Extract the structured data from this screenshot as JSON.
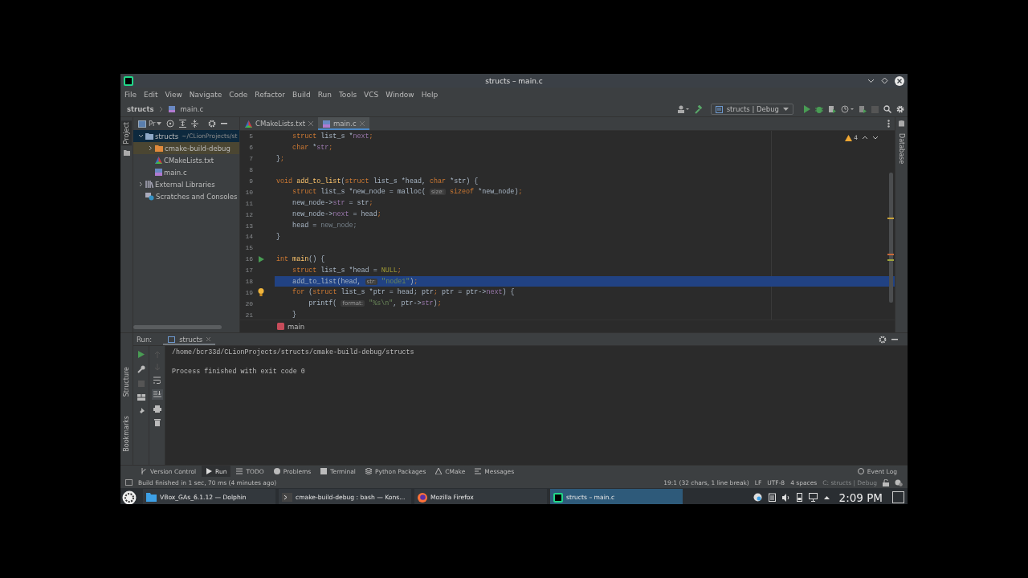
{
  "window": {
    "title": "structs – main.c"
  },
  "menu": [
    "File",
    "Edit",
    "View",
    "Navigate",
    "Code",
    "Refactor",
    "Build",
    "Run",
    "Tools",
    "VCS",
    "Window",
    "Help"
  ],
  "breadcrumb": [
    "structs",
    "main.c"
  ],
  "run_config": "structs | Debug",
  "left_strip": [
    "Project"
  ],
  "right_strip": [
    "Database"
  ],
  "project": {
    "title": "Pr",
    "tree": [
      {
        "label": "structs",
        "path": "~/CLionProjects/st",
        "kind": "project",
        "expanded": true,
        "selected": true,
        "children": [
          {
            "label": "cmake-build-debug",
            "kind": "excluded_folder",
            "expanded": false,
            "selected": false
          },
          {
            "label": "CMakeLists.txt",
            "kind": "cmake",
            "selected": false
          },
          {
            "label": "main.c",
            "kind": "c_file",
            "selected": false
          }
        ]
      },
      {
        "label": "External Libraries",
        "kind": "libraries",
        "expanded": false,
        "selected": false
      },
      {
        "label": "Scratches and Consoles",
        "kind": "scratches",
        "selected": false
      }
    ]
  },
  "editor_tabs": [
    {
      "label": "CMakeLists.txt",
      "kind": "cmake",
      "selected": false
    },
    {
      "label": "main.c",
      "kind": "c_file",
      "selected": true
    }
  ],
  "warnings": "4",
  "lines": [
    {
      "n": "5",
      "selected": false,
      "tokens": [
        {
          "kind": "kw",
          "text": "    struct"
        },
        {
          "kind": "plain",
          "text": " list_s *"
        },
        {
          "kind": "field",
          "text": "next"
        },
        {
          "kind": "kw",
          "text": ";"
        }
      ]
    },
    {
      "n": "6",
      "selected": false,
      "tokens": [
        {
          "kind": "kw",
          "text": "    char"
        },
        {
          "kind": "plain",
          "text": " *"
        },
        {
          "kind": "field",
          "text": "str"
        },
        {
          "kind": "kw",
          "text": ";"
        }
      ]
    },
    {
      "n": "7",
      "selected": false,
      "tokens": [
        {
          "kind": "plain",
          "text": "}"
        },
        {
          "kind": "kw",
          "text": ";"
        }
      ]
    },
    {
      "n": "8",
      "selected": false,
      "kind": "blank"
    },
    {
      "n": "9",
      "selected": false,
      "tokens": [
        {
          "kind": "kw",
          "text": "void "
        },
        {
          "kind": "fn",
          "text": "add_to_list"
        },
        {
          "kind": "plain",
          "text": "("
        },
        {
          "kind": "kw",
          "text": "struct"
        },
        {
          "kind": "plain",
          "text": " list_s *head, "
        },
        {
          "kind": "kw",
          "text": "char"
        },
        {
          "kind": "plain",
          "text": " *str) {"
        }
      ]
    },
    {
      "n": "10",
      "selected": false,
      "tokens": [
        {
          "kind": "kw",
          "text": "    struct"
        },
        {
          "kind": "plain",
          "text": " list_s *new_node = malloc( "
        },
        {
          "kind": "hint",
          "text": "size:"
        },
        {
          "kind": "kw",
          "text": " sizeof"
        },
        {
          "kind": "plain",
          "text": " *new_node)"
        },
        {
          "kind": "kw",
          "text": ";"
        }
      ]
    },
    {
      "n": "11",
      "selected": false,
      "tokens": [
        {
          "kind": "plain",
          "text": "    new_node->"
        },
        {
          "kind": "field",
          "text": "str"
        },
        {
          "kind": "plain",
          "text": " = str"
        },
        {
          "kind": "kw",
          "text": ";"
        }
      ]
    },
    {
      "n": "12",
      "selected": false,
      "tokens": [
        {
          "kind": "plain",
          "text": "    new_node->"
        },
        {
          "kind": "field",
          "text": "next"
        },
        {
          "kind": "plain",
          "text": " = head"
        },
        {
          "kind": "kw",
          "text": ";"
        }
      ]
    },
    {
      "n": "13",
      "selected": false,
      "tokens": [
        {
          "kind": "plain",
          "text": "    head = "
        },
        {
          "kind": "unused",
          "text": "new_node;"
        }
      ]
    },
    {
      "n": "14",
      "selected": false,
      "tokens": [
        {
          "kind": "plain",
          "text": "}"
        }
      ]
    },
    {
      "n": "15",
      "selected": false,
      "kind": "blank"
    },
    {
      "n": "16",
      "selected": false,
      "kind": "run_marker",
      "tokens": [
        {
          "kind": "kw",
          "text": "int "
        },
        {
          "kind": "fn",
          "text": "main"
        },
        {
          "kind": "plain",
          "text": "() {"
        }
      ]
    },
    {
      "n": "17",
      "selected": false,
      "tokens": [
        {
          "kind": "kw",
          "text": "    struct"
        },
        {
          "kind": "plain",
          "text": " list_s *head = "
        },
        {
          "kind": "macro",
          "text": "NULL"
        },
        {
          "kind": "kw",
          "text": ";"
        }
      ]
    },
    {
      "n": "18",
      "selected": true,
      "tokens": [
        {
          "kind": "plain",
          "text": "    add_to_list(head, "
        },
        {
          "kind": "hint",
          "text": "str:"
        },
        {
          "kind": "str",
          "text": " \"node1\""
        },
        {
          "kind": "plain",
          "text": ")"
        },
        {
          "kind": "kw",
          "text": ";"
        }
      ]
    },
    {
      "n": "19",
      "selected": false,
      "kind": "bulb_marker",
      "tokens": [
        {
          "kind": "kw",
          "text": "    for"
        },
        {
          "kind": "plain",
          "text": " ("
        },
        {
          "kind": "kw",
          "text": "struct"
        },
        {
          "kind": "plain",
          "text": " list_s *ptr = head; ptr"
        },
        {
          "kind": "kw",
          "text": ";"
        },
        {
          "kind": "plain",
          "text": " ptr = ptr->"
        },
        {
          "kind": "field",
          "text": "next"
        },
        {
          "kind": "plain",
          "text": ") {"
        }
      ]
    },
    {
      "n": "20",
      "selected": false,
      "tokens": [
        {
          "kind": "plain",
          "text": "        printf( "
        },
        {
          "kind": "hint",
          "text": "format:"
        },
        {
          "kind": "str",
          "text": " \"%s\\n\""
        },
        {
          "kind": "plain",
          "text": ", ptr->"
        },
        {
          "kind": "field",
          "text": "str"
        },
        {
          "kind": "plain",
          "text": ")"
        },
        {
          "kind": "kw",
          "text": ";"
        }
      ]
    },
    {
      "n": "21",
      "selected": false,
      "tokens": [
        {
          "kind": "plain",
          "text": "    }"
        }
      ]
    }
  ],
  "code_breadcrumb": "main",
  "run": {
    "label": "Run:",
    "tab": "structs",
    "output": [
      "/home/bcr33d/CLionProjects/structs/cmake-build-debug/structs",
      "Process finished with exit code 0"
    ]
  },
  "run_strip": [
    "Structure",
    "Bookmarks"
  ],
  "tool_tabs": [
    {
      "label": "Version Control",
      "kind": "vcs",
      "selected": false
    },
    {
      "label": "Run",
      "kind": "run",
      "selected": true
    },
    {
      "label": "TODO",
      "kind": "todo",
      "selected": false
    },
    {
      "label": "Problems",
      "kind": "problems",
      "selected": false
    },
    {
      "label": "Terminal",
      "kind": "terminal",
      "selected": false
    },
    {
      "label": "Python Packages",
      "kind": "packages",
      "selected": false
    },
    {
      "label": "CMake",
      "kind": "cmake",
      "selected": false
    },
    {
      "label": "Messages",
      "kind": "messages",
      "selected": false
    }
  ],
  "event_log": "Event Log",
  "status": {
    "message": "Build finished in 1 sec, 70 ms (4 minutes ago)",
    "items": [
      {
        "text": "19:1 (32 chars, 1 line break)",
        "dimmed": false
      },
      {
        "text": "LF",
        "dimmed": false
      },
      {
        "text": "UTF-8",
        "dimmed": false
      },
      {
        "text": "4 spaces",
        "dimmed": false
      },
      {
        "text": "C: structs | Debug",
        "dimmed": true
      }
    ]
  },
  "taskbar": {
    "tasks": [
      {
        "label": "VBox_GAs_6.1.12 — Dolphin",
        "kind": "folder",
        "selected": false
      },
      {
        "label": "cmake-build-debug : bash — Kons...",
        "kind": "terminal",
        "selected": false
      },
      {
        "label": "Mozilla Firefox",
        "kind": "browser",
        "selected": false
      },
      {
        "label": "structs – main.c",
        "kind": "ide",
        "selected": true
      }
    ],
    "clock": "2:09 PM"
  }
}
